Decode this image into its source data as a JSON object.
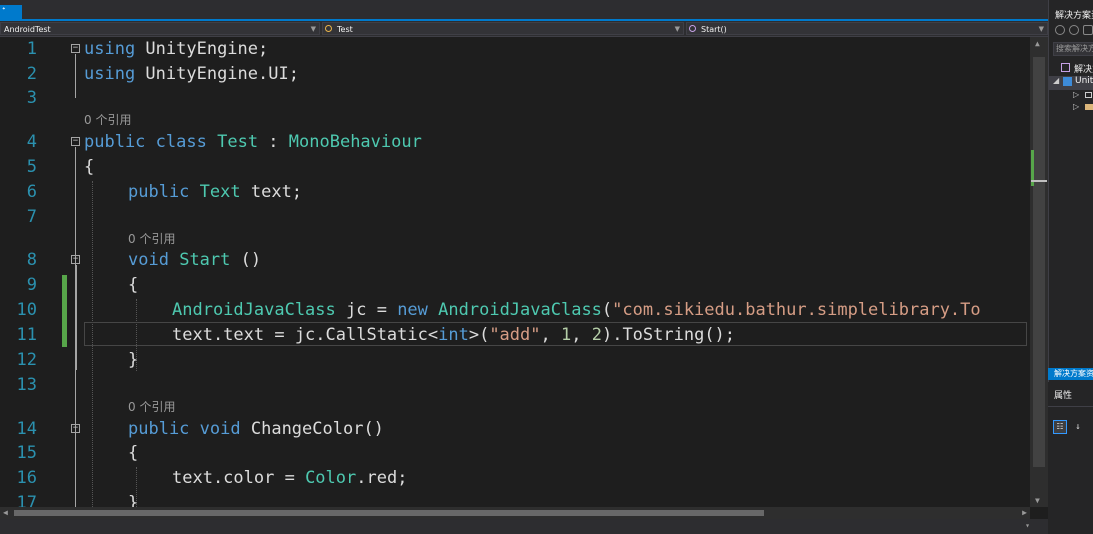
{
  "tabs": {
    "active_tab_icon": "pin-icon"
  },
  "navbar": {
    "project": "AndroidTest",
    "class": "Test",
    "member": "Start()"
  },
  "editor": {
    "line_numbers": [
      "1",
      "2",
      "3",
      "4",
      "5",
      "6",
      "7",
      "8",
      "9",
      "10",
      "11",
      "12",
      "13",
      "14",
      "15",
      "16",
      "17"
    ],
    "codelens": "0 个引用",
    "lines": {
      "l1": {
        "kw": "using",
        "rest": " UnityEngine;"
      },
      "l2": {
        "kw": "using",
        "rest": " UnityEngine.UI;"
      },
      "l4": {
        "kw1": "public",
        "kw2": "class",
        "name": "Test",
        "colon": " : ",
        "base": "MonoBehaviour"
      },
      "l5": "{",
      "l6": {
        "kw": "public",
        "type": "Text",
        "rest": " text;"
      },
      "l8": {
        "kw": "void",
        "name": "Start",
        "rest": " ()"
      },
      "l9": "{",
      "l10": {
        "type1": "AndroidJavaClass",
        "mid": " jc = ",
        "kw": "new",
        "type2": "AndroidJavaClass",
        "paren": "(",
        "str": "\"com.sikiedu.bathur.simplelibrary.To"
      },
      "l11": {
        "a": "text.text = jc.CallStatic<",
        "kw": "int",
        "b": ">(",
        "str": "\"add\"",
        "c": ", ",
        "n1": "1",
        "d": ", ",
        "n2": "2",
        "e": ").ToString();"
      },
      "l12": "}",
      "l14": {
        "kw1": "public",
        "kw2": "void",
        "rest": " ChangeColor()"
      },
      "l15": "{",
      "l16": {
        "a": "text.color = ",
        "type": "Color",
        "b": ".red;"
      },
      "l17": "}"
    }
  },
  "solution_explorer": {
    "title": "解决方案资源管理器",
    "search_placeholder": "搜索解决方案资源管理器",
    "solution_item": "解决方案",
    "project_item": "Unity"
  },
  "properties": {
    "title": "属性",
    "tab_label": "解决方案资源管理器"
  },
  "colors": {
    "accent": "#007acc",
    "keyword": "#569cd6",
    "type": "#4ec9b0",
    "string": "#d69d85",
    "number": "#b5cea8",
    "line_number": "#2b91af"
  }
}
